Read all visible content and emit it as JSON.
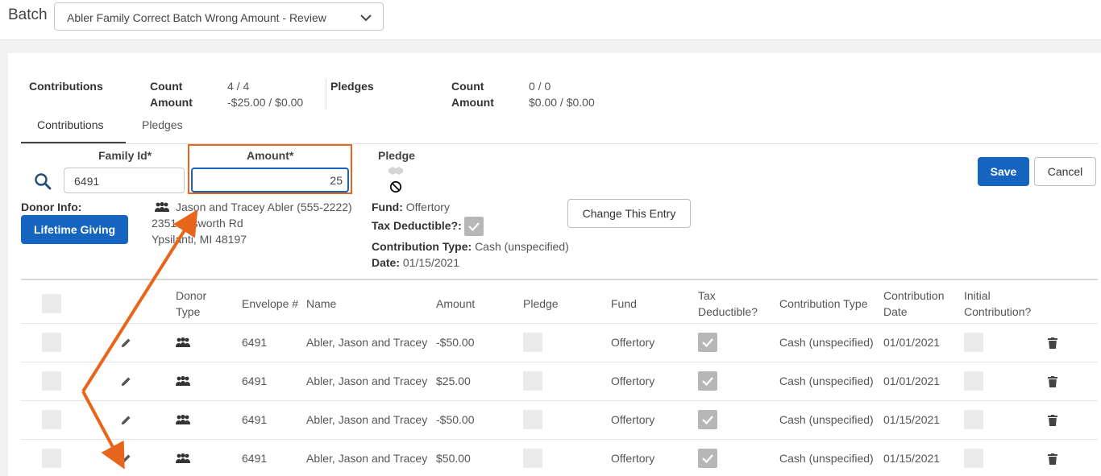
{
  "header": {
    "batch_label": "Batch",
    "batch_select_value": "Abler Family Correct Batch Wrong Amount - Review"
  },
  "summary": {
    "contributions_title": "Contributions",
    "contributions_count_label": "Count",
    "contributions_count_value": "4 / 4",
    "contributions_amount_label": "Amount",
    "contributions_amount_value": "-$25.00 / $0.00",
    "pledges_title": "Pledges",
    "pledges_count_label": "Count",
    "pledges_count_value": "0 / 0",
    "pledges_amount_label": "Amount",
    "pledges_amount_value": "$0.00 / $0.00"
  },
  "tabs": [
    {
      "label": "Contributions"
    },
    {
      "label": "Pledges"
    }
  ],
  "form": {
    "family_id_label": "Family Id*",
    "family_id_value": "6491",
    "amount_label": "Amount*",
    "amount_value": "25",
    "pledge_label": "Pledge",
    "save_label": "Save",
    "cancel_label": "Cancel",
    "donor_info_label": "Donor Info:",
    "lifetime_giving_label": "Lifetime Giving",
    "donor_name": "Jason and Tracey Abler (555-2222)",
    "donor_address1": "2351 Ellsworth Rd",
    "donor_address2": "Ypsilanti, MI 48197",
    "fund_label": "Fund:",
    "fund_value": "Offertory",
    "tax_label": "Tax Deductible?:",
    "contribution_type_label": "Contribution Type:",
    "contribution_type_value": "Cash (unspecified)",
    "date_label": "Date:",
    "date_value": "01/15/2021",
    "change_entry_label": "Change This Entry"
  },
  "table": {
    "headers": {
      "donor_type": "Donor Type",
      "envelope": "Envelope #",
      "name": "Name",
      "amount": "Amount",
      "pledge": "Pledge",
      "fund": "Fund",
      "tax": "Tax Deductible?",
      "contribution_type": "Contribution Type",
      "contribution_date": "Contribution Date",
      "initial": "Initial Contribution?"
    },
    "rows": [
      {
        "envelope": "6491",
        "name": "Abler, Jason and Tracey",
        "amount": "-$50.00",
        "fund": "Offertory",
        "type": "Cash (unspecified)",
        "date": "01/01/2021"
      },
      {
        "envelope": "6491",
        "name": "Abler, Jason and Tracey",
        "amount": "$25.00",
        "fund": "Offertory",
        "type": "Cash (unspecified)",
        "date": "01/01/2021"
      },
      {
        "envelope": "6491",
        "name": "Abler, Jason and Tracey",
        "amount": "-$50.00",
        "fund": "Offertory",
        "type": "Cash (unspecified)",
        "date": "01/15/2021"
      },
      {
        "envelope": "6491",
        "name": "Abler, Jason and Tracey",
        "amount": "$50.00",
        "fund": "Offertory",
        "type": "Cash (unspecified)",
        "date": "01/15/2021"
      }
    ]
  },
  "colors": {
    "accent": "#1565c0",
    "annotation": "#e8661c"
  }
}
